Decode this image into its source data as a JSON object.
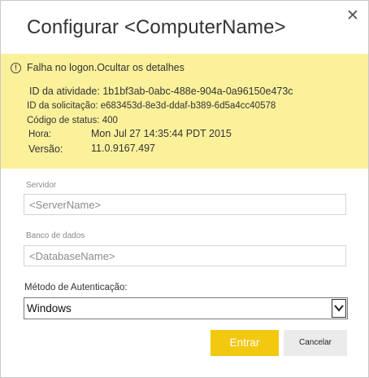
{
  "dialog": {
    "title": "Configurar <ComputerName>",
    "close_label": "✕"
  },
  "error": {
    "icon": "warning-circle-icon",
    "message": "Falha no logon.",
    "toggle_label": "Ocultar os detalhes",
    "activity_id": "ID da atividade: 1b1bf3ab-0abc-488e-904a-0a96150e473c",
    "request_id": "ID da solicitação: e683453d-8e3d-ddaf-b389-6d5a4cc40578",
    "status_code": "Código de status: 400",
    "time_label": "Hora:",
    "time_value": "Mon Jul 27 14:35:44 PDT 2015",
    "version_label": "Versão:",
    "version_value": "11.0.9167.497"
  },
  "form": {
    "server_label": "Servidor",
    "server_placeholder": "<ServerName>",
    "database_label": "Banco de dados",
    "database_placeholder": "<DatabaseName>",
    "auth_label": "Método de Autenticação:",
    "auth_value": "Windows"
  },
  "buttons": {
    "submit_label": "Entrar",
    "cancel_label": "Cancelar"
  },
  "colors": {
    "error_background": "#fbf19b",
    "primary_button": "#f2c811"
  }
}
